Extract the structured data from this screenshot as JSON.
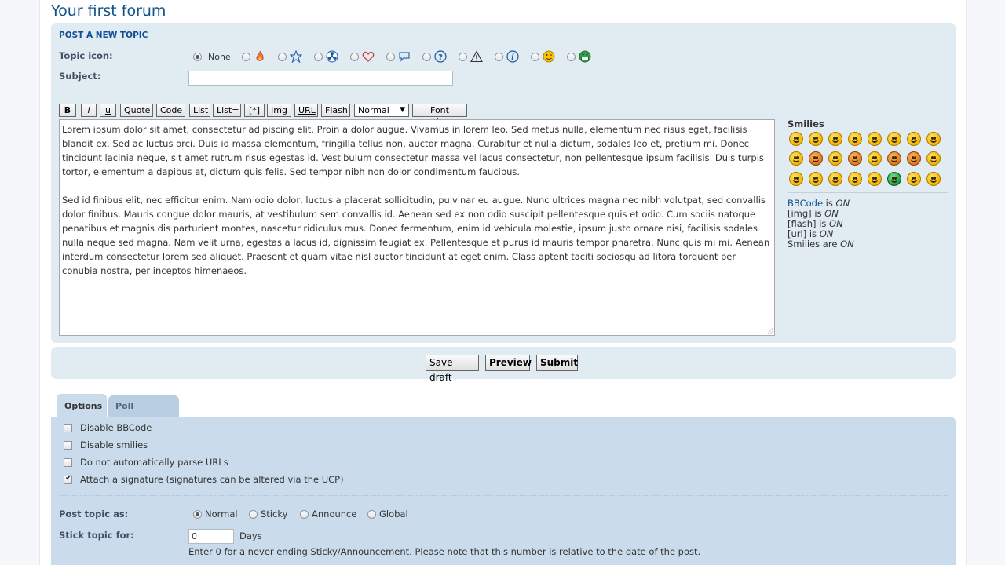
{
  "forum_title": "Your first forum",
  "post_panel": {
    "heading": "POST A NEW TOPIC",
    "topic_icon_label": "Topic icon:",
    "none_label": "None",
    "icons": [
      "fire-icon",
      "star-icon",
      "radioactive-icon",
      "heart-icon",
      "speech-bubble-icon",
      "question-icon",
      "warning-icon",
      "info-icon",
      "wink-smiley-icon",
      "grin-green-smiley-icon"
    ],
    "subject_label": "Subject:",
    "subject_value": ""
  },
  "toolbar": {
    "bold": "B",
    "italic": "i",
    "underline": "u",
    "quote": "Quote",
    "code": "Code",
    "list": "List",
    "list_ordered": "List=",
    "list_item": "[*]",
    "img": "Img",
    "url": "URL",
    "flash": "Flash",
    "font_size": "Normal",
    "font_colour": "Font colour"
  },
  "message": {
    "paragraph1": "Lorem ipsum dolor sit amet, consectetur adipiscing elit. Proin a dolor augue. Vivamus in lorem leo. Sed metus nulla, elementum nec risus eget, facilisis blandit ex. Sed ac luctus orci. Duis id massa elementum, fringilla tellus non, auctor magna. Curabitur et nulla dictum, sodales leo et, pretium mi. Donec tincidunt lacinia neque, sit amet rutrum risus egestas id. Vestibulum consectetur massa vel lacus consectetur, non pellentesque ipsum facilisis. Duis turpis tortor, elementum a dapibus at, dictum quis felis. Sed tempor nibh non dolor condimentum faucibus.",
    "paragraph2": "Sed id finibus elit, nec efficitur enim. Nam odio dolor, luctus a placerat sollicitudin, pulvinar eu augue. Nunc ultrices magna nec nibh volutpat, sed convallis dolor finibus. Mauris congue dolor mauris, at vestibulum sem convallis id. Aenean sed ex non odio suscipit pellentesque quis et odio. Cum sociis natoque penatibus et magnis dis parturient montes, nascetur ridiculus mus. Donec fermentum, enim id vehicula molestie, ipsum justo ornare nisi, facilisis sodales nulla neque sed magna. Nam velit urna, egestas a lacus id, dignissim feugiat ex. Pellentesque et purus id mauris tempor pharetra. Nunc quis mi mi. Aenean interdum consectetur lorem sed aliquet. Praesent et quam vitae nisl auctor tincidunt at eget enim. Class aptent taciti sociosqu ad litora torquent per conubia nostra, per inceptos himenaeos."
  },
  "smilies": {
    "title": "Smilies",
    "items": [
      "very-happy-smiley",
      "smile-smiley",
      "wink-smiley",
      "sad-smiley",
      "surprised-smiley",
      "shocked-smiley",
      "confused-smiley",
      "cool-smiley",
      "laughing-smiley",
      "mad-smiley",
      "razz-smiley",
      "embarrassed-smiley",
      "crying-smiley",
      "evil-smiley",
      "twisted-evil-smiley",
      "rolling-eyes-smiley",
      "exclamation-smiley",
      "question-smiley",
      "idea-smiley",
      "arrow-smiley",
      "neutral-smiley",
      "mr-green-smiley",
      "geek-smiley",
      "uber-geek-smiley"
    ]
  },
  "bbcode_status": {
    "bbcode_link": "BBCode",
    "bbcode_is": " is ",
    "bbcode_state": "ON",
    "img_label": "[img] is ",
    "img_state": "ON",
    "flash_label": "[flash] is ",
    "flash_state": "ON",
    "url_label": "[url] is ",
    "url_state": "ON",
    "smilies_label": "Smilies are ",
    "smilies_state": "ON"
  },
  "actions": {
    "save_draft": "Save draft",
    "preview": "Preview",
    "submit": "Submit"
  },
  "tabs": {
    "options": "Options",
    "poll": "Poll creation"
  },
  "options": {
    "disable_bbcode": "Disable BBCode",
    "disable_smilies": "Disable smilies",
    "no_parse_urls": "Do not automatically parse URLs",
    "attach_signature": "Attach a signature (signatures can be altered via the UCP)",
    "post_as_label": "Post topic as:",
    "post_as_options": [
      "Normal",
      "Sticky",
      "Announce",
      "Global"
    ],
    "stick_for_label": "Stick topic for:",
    "stick_days_value": "0",
    "days_label": "Days",
    "note": "Enter 0 for a never ending Sticky/Announcement. Please note that this number is relative to the date of the post."
  },
  "colors": {
    "panel_bg": "#e1ebf2",
    "options_bg": "#cadceb",
    "title_blue": "#105289",
    "label_blue": "#425067"
  }
}
